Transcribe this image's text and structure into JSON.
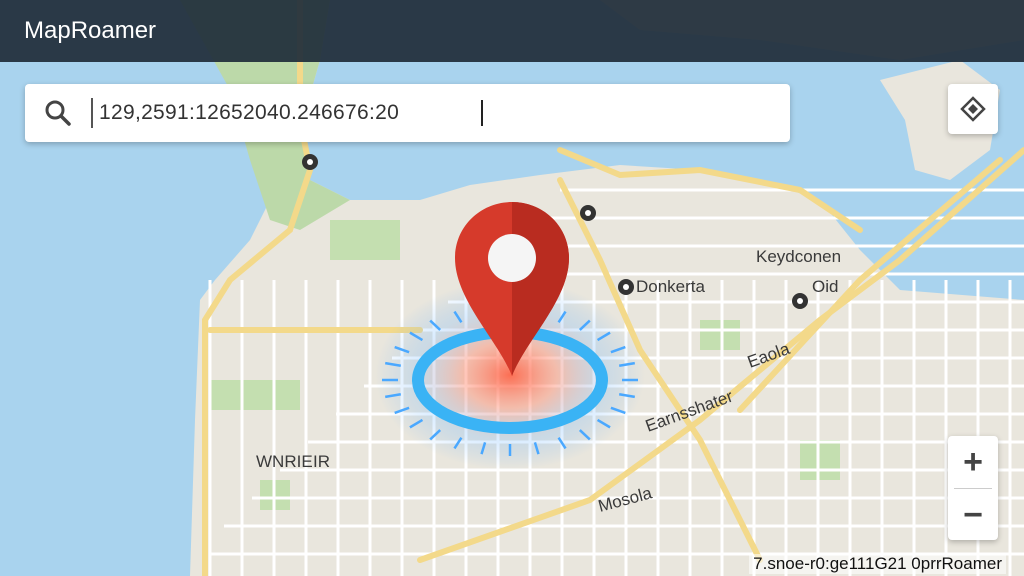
{
  "app": {
    "title": "MapRoamer"
  },
  "search": {
    "value": "129,2591:12652040.246676:20",
    "icon": "search-icon"
  },
  "controls": {
    "layers_icon": "layers-icon",
    "zoom_in_label": "+",
    "zoom_out_label": "−"
  },
  "map": {
    "labels": [
      "Donkerta",
      "Keydconen",
      "Oid",
      "Eaola",
      "Earnsshater",
      "Mosola",
      "WNRIE",
      "IR"
    ],
    "marker": {
      "type": "location-pin",
      "color": "#d63a2b"
    }
  },
  "attribution": "7.snoe-r0:ge111G21  0prrRoamer"
}
